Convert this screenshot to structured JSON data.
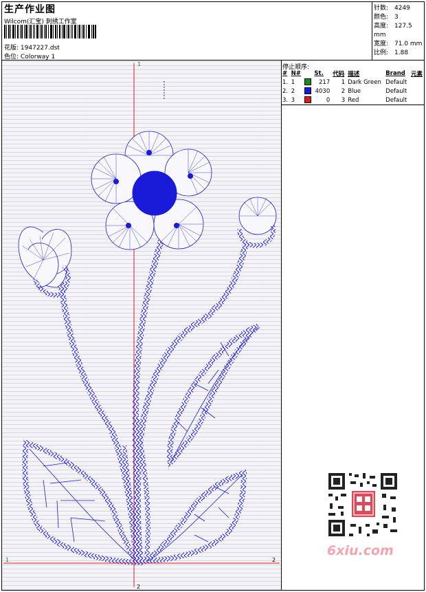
{
  "header": {
    "title": "生产作业图",
    "company": "Wilcom(汇宝) 刺绣工作室",
    "design_label": "花版:",
    "design_value": "1947227.dst",
    "colorway_label": "色位:",
    "colorway_value": "Colorway 1"
  },
  "stats": [
    {
      "label": "针数:",
      "value": "4249"
    },
    {
      "label": "颜色:",
      "value": "3"
    },
    {
      "label": "高度:",
      "value": "127.5 mm"
    },
    {
      "label": "宽度:",
      "value": "71.0 mm"
    },
    {
      "label": "比例:",
      "value": "1.88"
    }
  ],
  "stop_sequence": {
    "title": "停止顺序:",
    "columns": [
      "#",
      "N#",
      "St.",
      "代码",
      "描述",
      "Brand",
      "元素"
    ],
    "rows": [
      {
        "idx": "1.",
        "n": "1",
        "color": "#1a8c1a",
        "st": "217",
        "code": "1",
        "desc": "Dark Green",
        "brand": "Default"
      },
      {
        "idx": "2.",
        "n": "2",
        "color": "#1a1ad9",
        "st": "4030",
        "code": "2",
        "desc": "Blue",
        "brand": "Default"
      },
      {
        "idx": "3.",
        "n": "3",
        "color": "#e01b1b",
        "st": "0",
        "code": "3",
        "desc": "Red",
        "brand": "Default"
      }
    ]
  },
  "axes": {
    "top": "1",
    "bottom": "2",
    "left": "1",
    "right": "2"
  },
  "watermark": "6xiu.com",
  "colors": {
    "thread": "#1a1ad9",
    "axis": "#e31b1b",
    "accent_green": "#1a8c1a"
  }
}
